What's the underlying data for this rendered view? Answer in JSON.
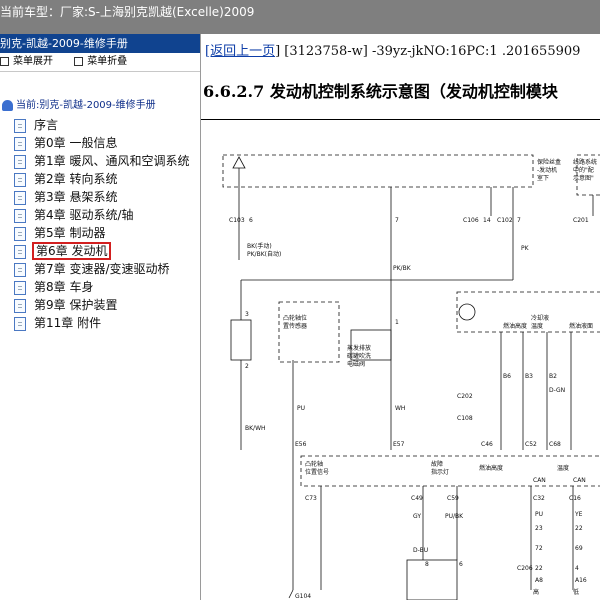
{
  "title": "当前车型：厂家:S-上海别克凯越(Excelle)2009",
  "left": {
    "header": "别克-凯越-2009-维修手册",
    "toolbar": {
      "expand": "菜单展开",
      "collapse": "菜单折叠"
    },
    "root": "当前:别克-凯越-2009-维修手册",
    "items": [
      {
        "label": "序言"
      },
      {
        "label": "第0章 一般信息"
      },
      {
        "label": "第1章 暖风、通风和空调系统"
      },
      {
        "label": "第2章 转向系统"
      },
      {
        "label": "第3章 悬架系统"
      },
      {
        "label": "第4章 驱动系统/轴"
      },
      {
        "label": "第5章 制动器"
      },
      {
        "label": "第6章 发动机",
        "selected": true
      },
      {
        "label": "第7章 变速器/变速驱动桥"
      },
      {
        "label": "第8章 车身"
      },
      {
        "label": "第9章 保护装置"
      },
      {
        "label": "第11章 附件"
      }
    ]
  },
  "content": {
    "back_link": "[返回上一页",
    "id_text": "] [3123758-w] -39yz-jkNO:16PC:1 .201655909",
    "heading": "6.6.2.7 发动机控制系统示意图（发动机控制模块",
    "diagram": {
      "labels": {
        "c103": "C103",
        "pin6": "6",
        "pin7": "7",
        "c106": "C106",
        "c102": "C102",
        "c201": "C201",
        "pin14": "14",
        "pin7b": "7",
        "wire_bk": "BK(手动)",
        "wire_pkbk": "PK/BK(自动)",
        "wire_pkbk2": "PK/BK",
        "wire_pk": "PK",
        "fuse_note1": "保险丝盒",
        "fuse_note2": "-发动机",
        "fuse_note3": "室下",
        "junction1": "线路系统",
        "junction2": "中的\"配",
        "junction3": "示意图\"",
        "cam_sensor1": "凸轮轴位",
        "cam_sensor2": "置传感器",
        "purge1": "蒸发排放",
        "purge2": "碳罐吹洗",
        "purge3": "电磁阀",
        "fuel_pump": "燃油高度",
        "coolant1": "冷却液",
        "coolant2": "温度",
        "fuel_level": "燃油液面",
        "wire_pu": "PU",
        "wire_wh": "WH",
        "wire_bkwh": "BK/WH",
        "c202": "C202",
        "c108": "C108",
        "c46": "C46",
        "c52": "C52",
        "c68": "C68",
        "b6": "B6",
        "b3": "B3",
        "b2": "B2",
        "e56": "E56",
        "e57": "E57",
        "cam_signal1": "凸轮轴",
        "cam_signal2": "位置信号",
        "mil1": "故障",
        "mil2": "指示灯",
        "fuel_h": "燃油高度",
        "temp": "温度",
        "can_h": "CAN",
        "can_l": "CAN",
        "c73": "C73",
        "c49": "C49",
        "c59": "C59",
        "c32": "C32",
        "c16": "C16",
        "gy": "GY",
        "pubk": "PU/BK",
        "dbu": "D-BU",
        "c206": "C206",
        "g104": "G104",
        "can_high": "高",
        "can_low": "低",
        "ye": "YE",
        "pu2": "PU",
        "dgn": "D-GN",
        "wire_num1": "23",
        "wire_num2": "22",
        "wire_num3": "72",
        "wire_num4": "69",
        "wire_num5": "22",
        "wire_num6": "4",
        "a8": "A8",
        "a16": "A16",
        "wire_num7": "3",
        "wire_num8": "6",
        "wire_num9": "2",
        "wire_num10": "1",
        "wire_num11": "8"
      }
    }
  },
  "colors": {
    "title_bg": "#7f7f7f",
    "header_bg": "#10438f",
    "selection": "#d21f1f",
    "link": "#0e3ea8"
  }
}
